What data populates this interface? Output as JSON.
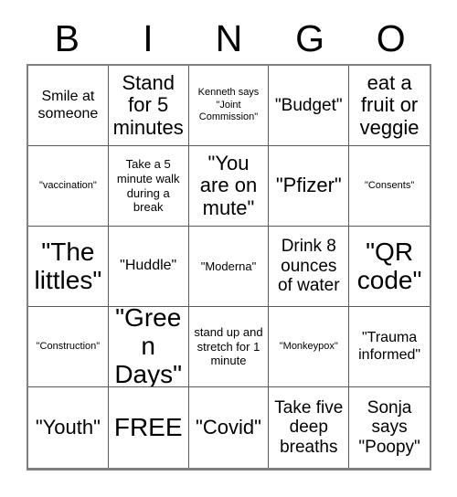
{
  "card": {
    "header_letters": [
      "B",
      "I",
      "N",
      "G",
      "O"
    ],
    "rows": [
      [
        {
          "text": "Smile at someone",
          "size": "md"
        },
        {
          "text": "Stand for 5 minutes",
          "size": "xl"
        },
        {
          "text": "Kenneth says \"Joint Commission\"",
          "size": "xs"
        },
        {
          "text": "\"Budget\"",
          "size": "lg"
        },
        {
          "text": "eat a fruit or veggie",
          "size": "xl"
        }
      ],
      [
        {
          "text": "\"vaccination\"",
          "size": "xs"
        },
        {
          "text": "Take a 5 minute walk during a break",
          "size": "sm"
        },
        {
          "text": "\"You are on mute\"",
          "size": "xl"
        },
        {
          "text": "\"Pfizer\"",
          "size": "xl"
        },
        {
          "text": "\"Consents\"",
          "size": "xs"
        }
      ],
      [
        {
          "text": "\"The littles\"",
          "size": "xxl"
        },
        {
          "text": "\"Huddle\"",
          "size": "md"
        },
        {
          "text": "\"Moderna\"",
          "size": "sm"
        },
        {
          "text": "Drink 8 ounces of water",
          "size": "lg"
        },
        {
          "text": "\"QR code\"",
          "size": "xxl"
        }
      ],
      [
        {
          "text": "\"Construction\"",
          "size": "xs"
        },
        {
          "text": "\"Green Days\"",
          "size": "xxl"
        },
        {
          "text": "stand up and stretch for 1 minute",
          "size": "sm"
        },
        {
          "text": "\"Monkeypox\"",
          "size": "xs"
        },
        {
          "text": "\"Trauma informed\"",
          "size": "md"
        }
      ],
      [
        {
          "text": "\"Youth\"",
          "size": "xl"
        },
        {
          "text": "FREE",
          "size": "xxl"
        },
        {
          "text": "\"Covid\"",
          "size": "xl"
        },
        {
          "text": "Take five deep breaths",
          "size": "lg"
        },
        {
          "text": "Sonja says \"Poopy\"",
          "size": "lg"
        }
      ]
    ]
  },
  "colors": {
    "background": "#ffffff",
    "text": "#000000",
    "grid_line": "#5a5a5a",
    "grid_outer": "#808080"
  }
}
